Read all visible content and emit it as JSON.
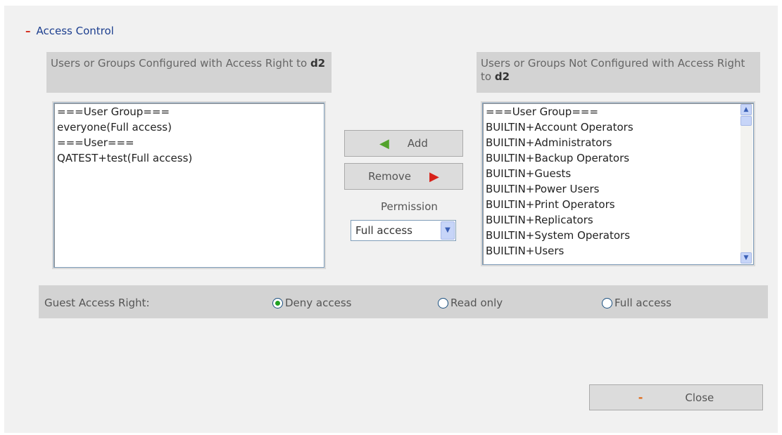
{
  "section_title": "Access Control",
  "left_header": {
    "text": "Users or Groups Configured with Access Right to ",
    "folder": "d2"
  },
  "right_header": {
    "text": "Users or Groups Not Configured with Access Right to ",
    "folder": "d2"
  },
  "left_list": [
    "===User Group===",
    "everyone(Full access)",
    "===User===",
    "QATEST+test(Full access)"
  ],
  "right_list": [
    "===User Group===",
    "BUILTIN+Account Operators",
    "BUILTIN+Administrators",
    "BUILTIN+Backup Operators",
    "BUILTIN+Guests",
    "BUILTIN+Power Users",
    "BUILTIN+Print Operators",
    "BUILTIN+Replicators",
    "BUILTIN+System Operators",
    "BUILTIN+Users"
  ],
  "buttons": {
    "add": "Add",
    "remove": "Remove",
    "close": "Close"
  },
  "permission": {
    "label": "Permission",
    "selected": "Full access"
  },
  "guest": {
    "label": "Guest Access Right:",
    "options": [
      "Deny access",
      "Read only",
      "Full access"
    ],
    "selected": "Deny access"
  },
  "colors": {
    "title": "#1d3f8f",
    "minus": "#d42b1b",
    "add_arrow": "#53a32c",
    "remove_arrow": "#d7221a",
    "radio_checked": "#21a121"
  }
}
